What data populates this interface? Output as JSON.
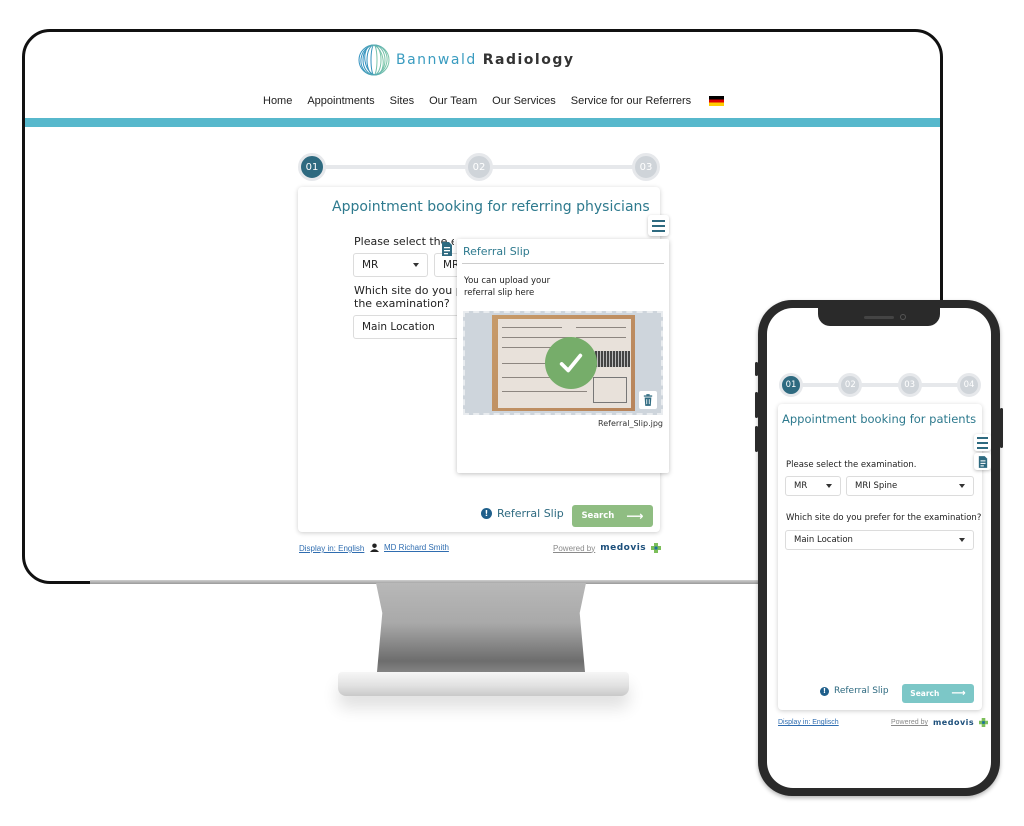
{
  "desktop": {
    "logo": {
      "word1": "Bannwald",
      "word2": "Radiology"
    },
    "nav": {
      "items": [
        "Home",
        "Appointments",
        "Sites",
        "Our Team",
        "Our Services",
        "Service for our Referrers"
      ],
      "language_flag": "german-flag-icon"
    },
    "stepper": {
      "steps": [
        "01",
        "02",
        "03"
      ],
      "active_index": 0
    },
    "card": {
      "title": "Appointment booking for referring physicians",
      "exam_label": "Please select the examination.",
      "modality_value": "MR",
      "exam_value": "MRI Spine",
      "site_label": "Which site do you prefer for the examination?",
      "site_value": "Main Location"
    },
    "referral_popup": {
      "title": "Referral Slip",
      "text": "You can upload your referral slip here",
      "file_name": "Referral_Slip.jpg",
      "upload_status": "uploaded"
    },
    "footer_actions": {
      "referral_link": "Referral Slip",
      "search_button": "Search",
      "search_color": "#8fbd82"
    },
    "footer": {
      "display_language": "Display in: English",
      "user": "MD Richard Smith",
      "powered_by": "Powered by",
      "brand": "medovis"
    }
  },
  "mobile": {
    "stepper": {
      "steps": [
        "01",
        "02",
        "03",
        "04"
      ],
      "active_index": 0
    },
    "card": {
      "title": "Appointment booking for patients",
      "exam_label": "Please select the examination.",
      "modality_value": "MR",
      "exam_value": "MRI Spine",
      "site_label": "Which site do you prefer for the examination?",
      "site_value": "Main Location"
    },
    "footer_actions": {
      "referral_link": "Referral Slip",
      "search_button": "Search",
      "search_color": "#7cc7c7"
    },
    "footer": {
      "display_language": "Display in: Englisch",
      "powered_by": "Powered by",
      "brand": "medovis"
    }
  },
  "colors": {
    "primary": "#2e6a80",
    "accent_bar": "#57b8cc",
    "title": "#2e7a8e",
    "success": "#76ad6a"
  }
}
